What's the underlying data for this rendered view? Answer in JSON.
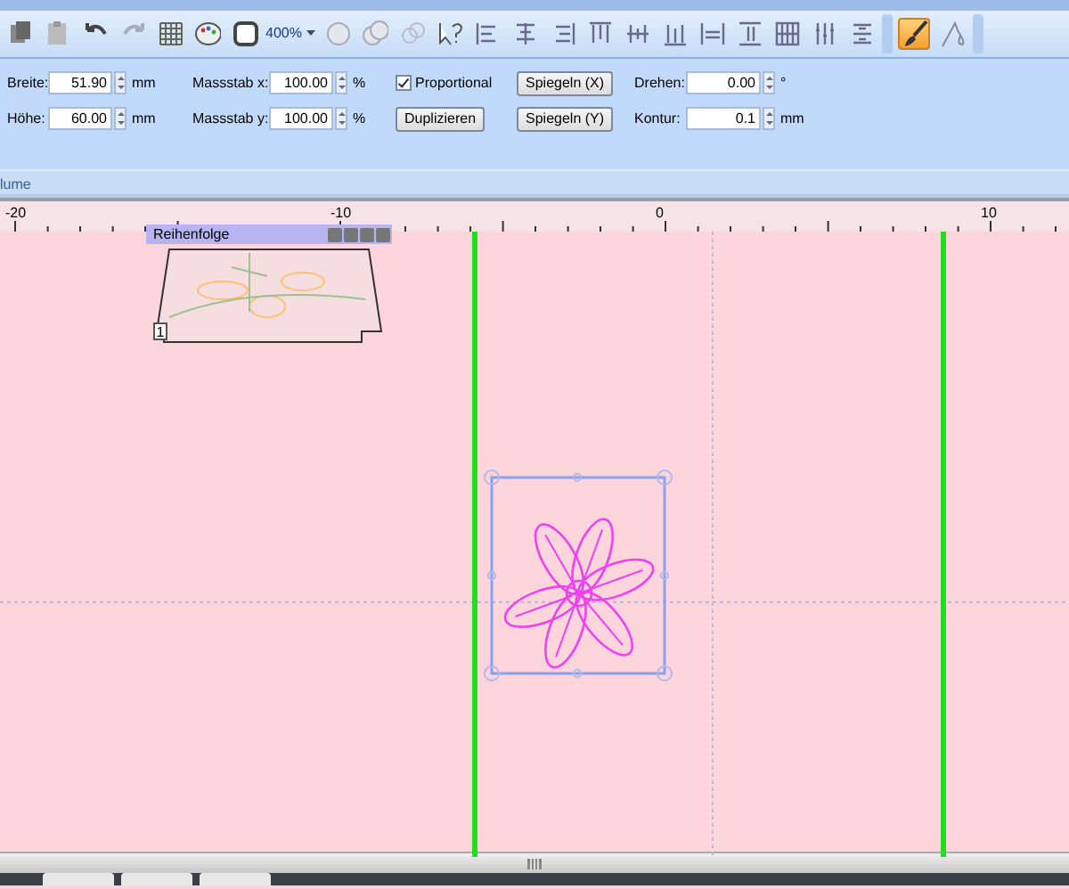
{
  "toolbar": {
    "zoom": "400%",
    "tools": [
      {
        "selected": true
      },
      {
        "selected": false
      }
    ]
  },
  "properties": {
    "rows": [
      {
        "label": "Breite:",
        "value": "51.90",
        "unit": "mm",
        "scale_label": "Massstab x:",
        "scale_value": "100.00",
        "scale_unit": "%",
        "extra": {
          "kind": "checkbox",
          "label": "Proportional",
          "checked": true
        },
        "mirror": "Spiegeln (X)",
        "angle_label": "Drehen:",
        "angle_value": "0.00",
        "angle_unit": "°"
      },
      {
        "label": "Höhe:",
        "value": "60.00",
        "unit": "mm",
        "scale_label": "Massstab y:",
        "scale_value": "100.00",
        "scale_unit": "%",
        "extra": {
          "kind": "button",
          "label": "Duplizieren"
        },
        "mirror": "Spiegeln (Y)",
        "angle_label": "Kontur:",
        "angle_value": "0.1",
        "angle_unit": "mm"
      }
    ]
  },
  "tab_strip": {
    "label": "lume"
  },
  "ruler": {
    "labels": [
      "-20",
      "-10",
      "0",
      "10"
    ]
  },
  "order_panel": {
    "title": "Reihenfolge",
    "index": "1"
  }
}
